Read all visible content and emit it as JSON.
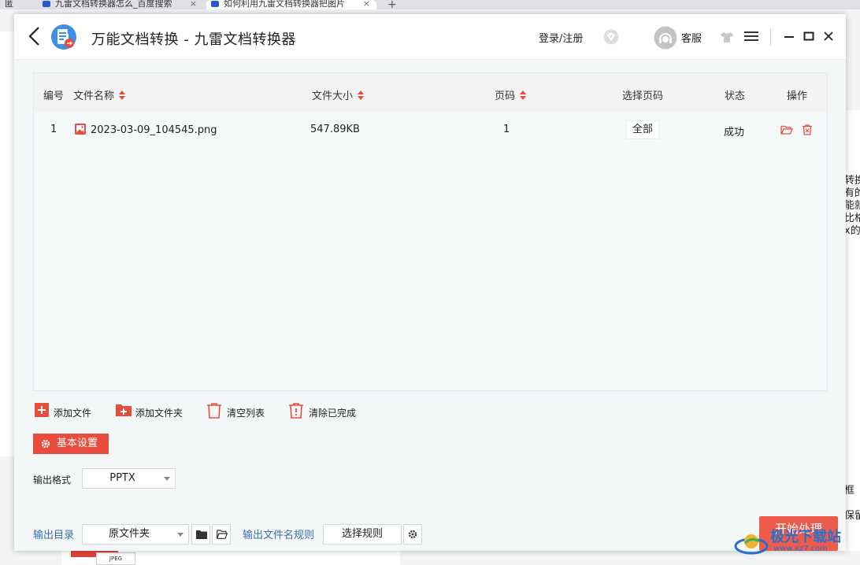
{
  "browser": {
    "tabs": [
      {
        "label": "匿"
      },
      {
        "label": "九雷文档转换器怎么_百度搜索"
      },
      {
        "label": "如何利用九雷文档转换器把图片"
      }
    ],
    "right_text": [
      "转换",
      "有的",
      "能就",
      "比格",
      "x的",
      "框",
      "保留"
    ]
  },
  "app": {
    "title": "万能文档转换 - 九雷文档转换器",
    "login": "登录/注册",
    "service": "客服"
  },
  "table": {
    "headers": {
      "index": "编号",
      "filename": "文件名称",
      "filesize": "文件大小",
      "pages": "页码",
      "select_pages": "选择页码",
      "status": "状态",
      "actions": "操作"
    },
    "rows": [
      {
        "index": "1",
        "filename": "2023-03-09_104545.png",
        "filesize": "547.89KB",
        "pages": "1",
        "select_pages": "全部",
        "status": "成功"
      }
    ]
  },
  "toolbar": {
    "add_file": "添加文件",
    "add_folder": "添加文件夹",
    "clear_list": "清空列表",
    "clear_done": "清除已完成"
  },
  "settings": {
    "basic_settings": "基本设置",
    "output_format_label": "输出格式",
    "output_format": "PPTX",
    "output_dir_label": "输出目录",
    "output_dir": "原文件夹",
    "filename_rule_label": "输出文件名规则",
    "choose_rule": "选择规则",
    "start": "开始处理"
  },
  "watermark": {
    "text": "极光下载站",
    "url": "www.xz7.com"
  },
  "colors": {
    "accent": "#e84c3d",
    "blue_label": "#3a6fb0"
  }
}
